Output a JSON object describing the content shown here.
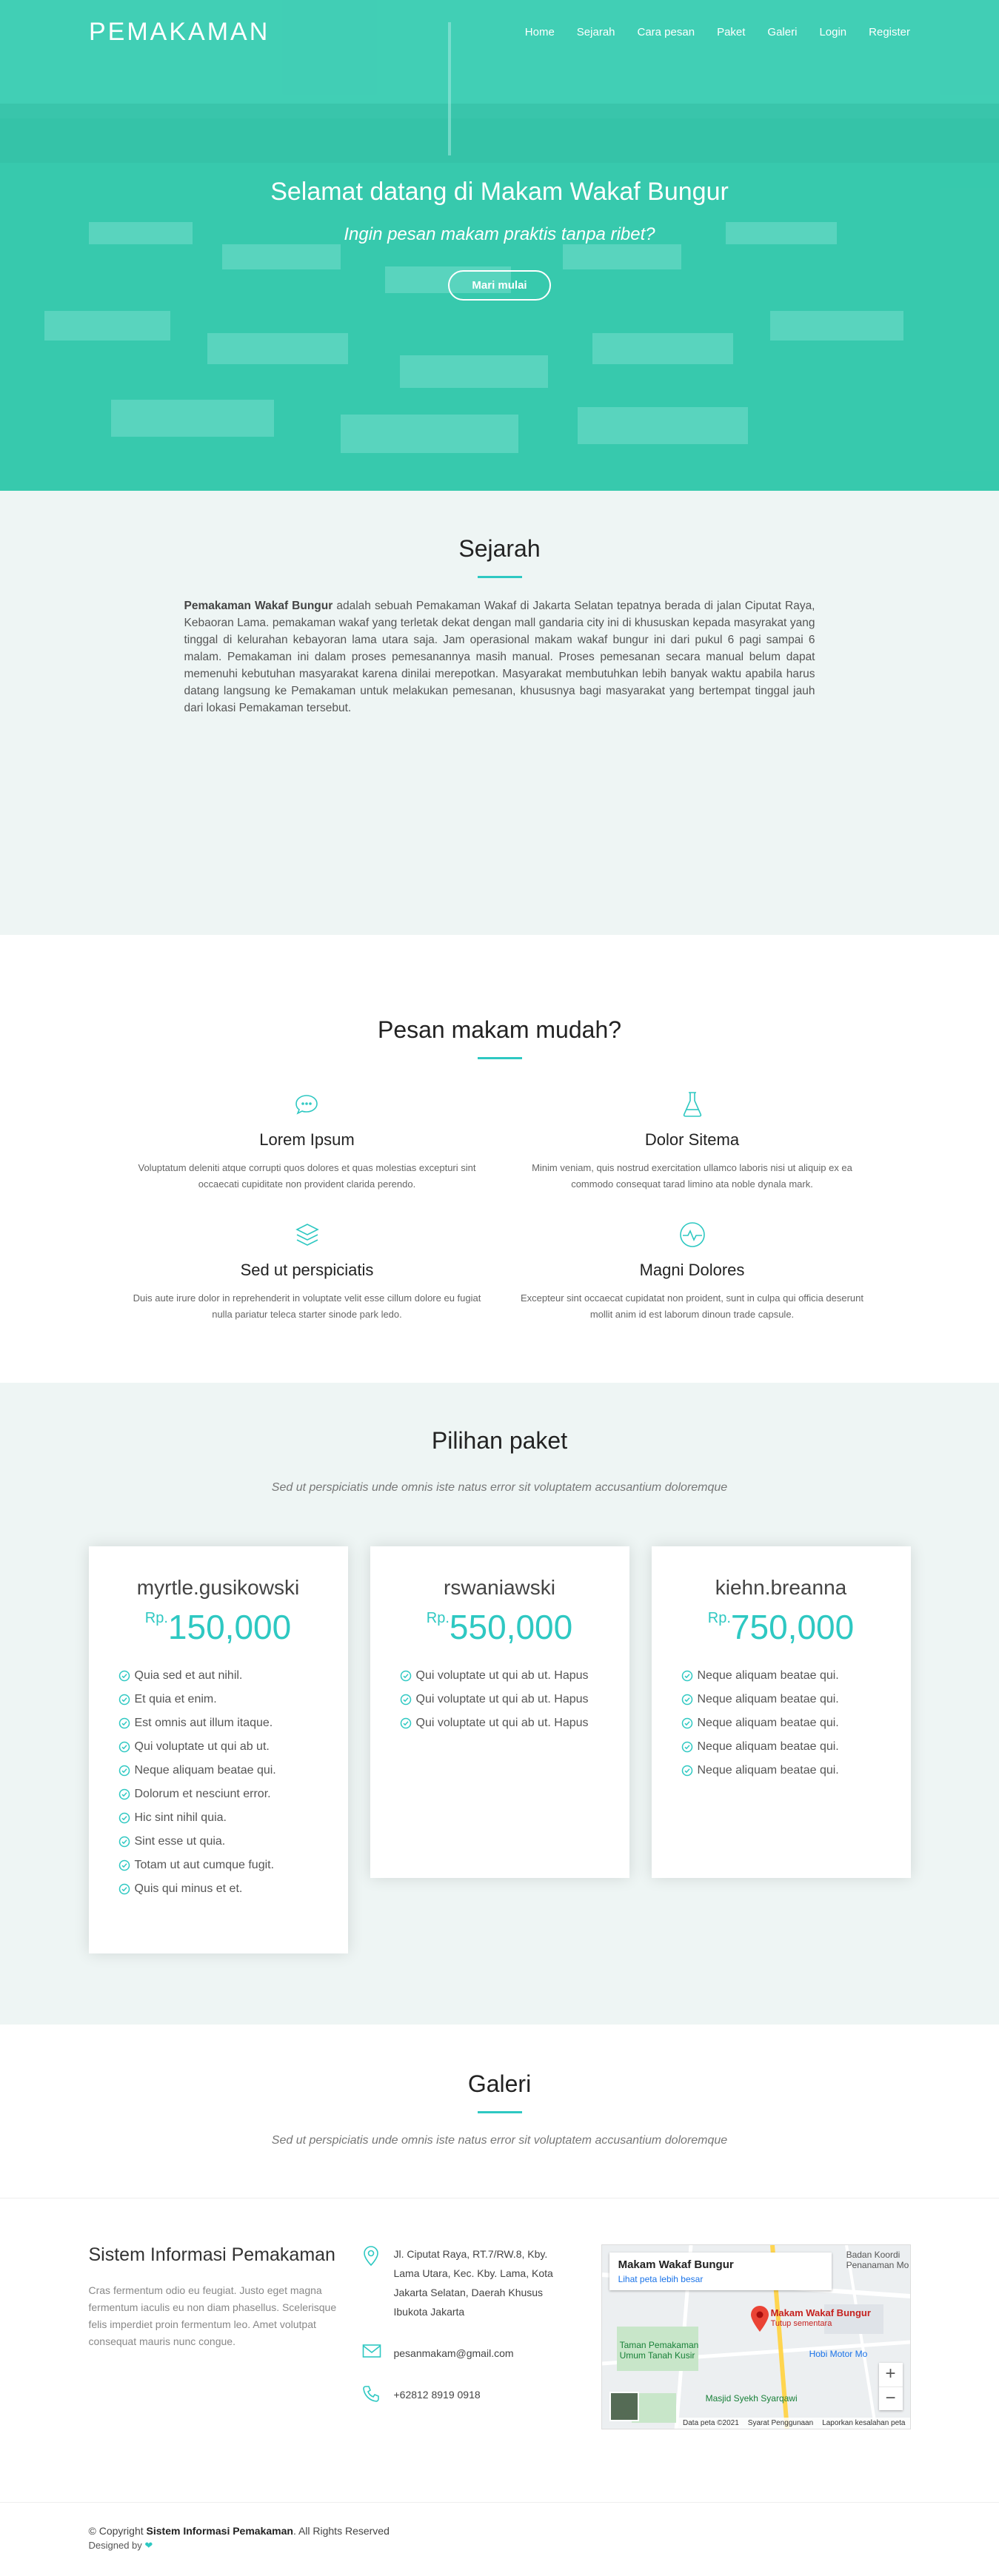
{
  "nav": {
    "logo": "PEMAKAMAN",
    "links": [
      "Home",
      "Sejarah",
      "Cara pesan",
      "Paket",
      "Galeri",
      "Login",
      "Register"
    ]
  },
  "hero": {
    "title": "Selamat datang di Makam Wakaf Bungur",
    "subtitle": "Ingin pesan makam praktis tanpa ribet?",
    "button": "Mari mulai"
  },
  "sejarah": {
    "title": "Sejarah",
    "lead": "Pemakaman Wakaf Bungur",
    "text": " adalah sebuah Pemakaman Wakaf di Jakarta Selatan tepatnya berada di jalan Ciputat Raya, Kebaoran Lama. pemakaman wakaf yang terletak dekat dengan mall gandaria city ini di khususkan kepada masyrakat yang tinggal di kelurahan kebayoran lama utara saja. Jam operasional makam wakaf bungur ini dari pukul 6 pagi sampai 6 malam. Pemakaman ini dalam proses pemesanannya masih manual. Proses pemesanan secara manual belum dapat memenuhi kebutuhan masyarakat karena dinilai merepotkan. Masyarakat membutuhkan lebih banyak waktu apabila harus datang langsung ke Pemakaman untuk melakukan pemesanan, khususnya bagi masyarakat yang bertempat tinggal jauh dari lokasi Pemakaman tersebut."
  },
  "pesan": {
    "title": "Pesan makam mudah?",
    "features": [
      {
        "icon": "chat-bubbles-icon",
        "title": "Lorem Ipsum",
        "text": "Voluptatum deleniti atque corrupti quos dolores et quas molestias excepturi sint occaecati cupiditate non provident clarida perendo."
      },
      {
        "icon": "flask-icon",
        "title": "Dolor Sitema",
        "text": "Minim veniam, quis nostrud exercitation ullamco laboris nisi ut aliquip ex ea commodo consequat tarad limino ata noble dynala mark."
      },
      {
        "icon": "layers-icon",
        "title": "Sed ut perspiciatis",
        "text": "Duis aute irure dolor in reprehenderit in voluptate velit esse cillum dolore eu fugiat nulla pariatur teleca starter sinode park ledo."
      },
      {
        "icon": "pulse-icon",
        "title": "Magni Dolores",
        "text": "Excepteur sint occaecat cupidatat non proident, sunt in culpa qui officia deserunt mollit anim id est laborum dinoun trade capsule."
      }
    ]
  },
  "paket": {
    "title": "Pilihan paket",
    "subtitle": "Sed ut perspiciatis unde omnis iste natus error sit voluptatem accusantium doloremque",
    "currency": "Rp.",
    "cards": [
      {
        "name": "myrtle.gusikowski",
        "price": "150,000",
        "features": [
          "Quia sed et aut nihil.",
          "Et quia et enim.",
          "Est omnis aut illum itaque.",
          "Qui voluptate ut qui ab ut.",
          "Neque aliquam beatae qui.",
          "Dolorum et nesciunt error.",
          "Hic sint nihil quia.",
          "Sint esse ut quia.",
          "Totam ut aut cumque fugit.",
          "Quis qui minus et et."
        ]
      },
      {
        "name": "rswaniawski",
        "price": "550,000",
        "features": [
          "Qui voluptate ut qui ab ut. Hapus",
          "Qui voluptate ut qui ab ut. Hapus",
          "Qui voluptate ut qui ab ut. Hapus"
        ]
      },
      {
        "name": "kiehn.breanna",
        "price": "750,000",
        "features": [
          "Neque aliquam beatae qui.",
          "Neque aliquam beatae qui.",
          "Neque aliquam beatae qui.",
          "Neque aliquam beatae qui.",
          "Neque aliquam beatae qui."
        ]
      }
    ]
  },
  "galeri": {
    "title": "Galeri",
    "subtitle": "Sed ut perspiciatis unde omnis iste natus error sit voluptatem accusantium doloremque"
  },
  "footer": {
    "title": "Sistem Informasi Pemakaman",
    "about": "Cras fermentum odio eu feugiat. Justo eget magna fermentum iaculis eu non diam phasellus. Scelerisque felis imperdiet proin fermentum leo. Amet volutpat consequat mauris nunc congue.",
    "address": "Jl. Ciputat Raya, RT.7/RW.8, Kby. Lama Utara, Kec. Kby. Lama, Kota Jakarta Selatan, Daerah Khusus Ibukota Jakarta",
    "email": "pesanmakam@gmail.com",
    "phone": "+62812 8919 0918",
    "map": {
      "place": "Makam Wakaf Bungur",
      "link": "Lihat peta lebih besar",
      "pin_label": "Makam Wakaf Bungur",
      "pin_status": "Tutup sementara",
      "label_badan": "Badan Koordi Penanaman Mo",
      "label_taman": "Taman Pemakaman Umum Tanah Kusir",
      "label_hobi": "Hobi Motor Mo",
      "label_masjid": "Masjid Syekh Syarqawi",
      "data": "Data peta ©2021",
      "terms": "Syarat Penggunaan",
      "report": "Laporkan kesalahan peta"
    },
    "copyright_prefix": "© Copyright ",
    "copyright_name": "Sistem Informasi Pemakaman",
    "copyright_suffix": ". All Rights Reserved",
    "designed": "Designed by "
  },
  "colors": {
    "accent": "#2ec8c2",
    "hero": "#35c9b6",
    "section_bg": "#eef5f4"
  }
}
